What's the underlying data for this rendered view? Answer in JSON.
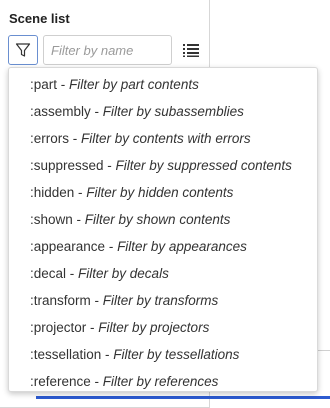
{
  "panel": {
    "title": "Scene list",
    "filter_button_icon": "filter-icon",
    "search": {
      "placeholder": "Filter by name",
      "value": ""
    },
    "list_view_icon": "list-view-icon"
  },
  "dropdown": {
    "items": [
      {
        "keyword": ":part",
        "sep": " - ",
        "description": "Filter by part contents"
      },
      {
        "keyword": ":assembly",
        "sep": " - ",
        "description": "Filter by subassemblies"
      },
      {
        "keyword": ":errors",
        "sep": " - ",
        "description": "Filter by contents with errors"
      },
      {
        "keyword": ":suppressed",
        "sep": " - ",
        "description": "Filter by suppressed contents"
      },
      {
        "keyword": ":hidden",
        "sep": " - ",
        "description": "Filter by hidden contents"
      },
      {
        "keyword": ":shown",
        "sep": " - ",
        "description": "Filter by shown contents"
      },
      {
        "keyword": ":appearance",
        "sep": " - ",
        "description": "Filter by appearances"
      },
      {
        "keyword": ":decal",
        "sep": " - ",
        "description": "Filter by decals"
      },
      {
        "keyword": ":transform",
        "sep": " - ",
        "description": "Filter by transforms"
      },
      {
        "keyword": ":projector",
        "sep": " - ",
        "description": "Filter by projectors"
      },
      {
        "keyword": ":tessellation",
        "sep": " - ",
        "description": "Filter by tessellations"
      },
      {
        "keyword": ":reference",
        "sep": " - ",
        "description": "Filter by references"
      }
    ]
  },
  "colors": {
    "filter_button_border": "#6a8fd0",
    "accent_blue": "#2d5bd0",
    "text": "#333333"
  }
}
